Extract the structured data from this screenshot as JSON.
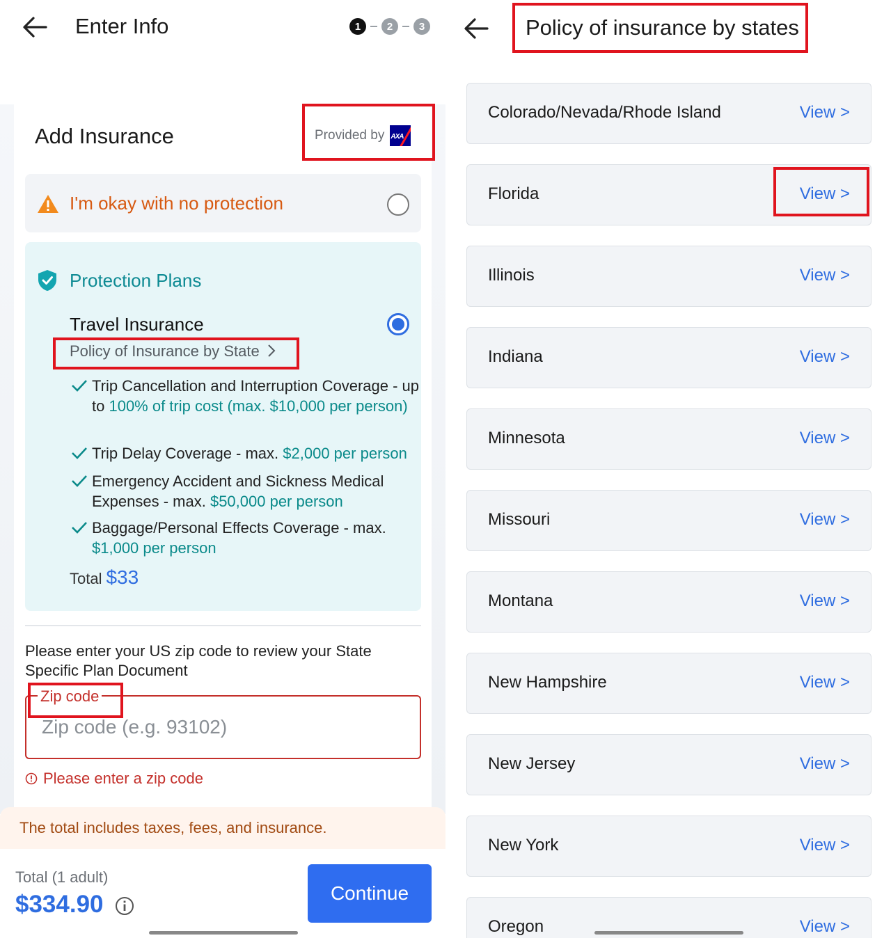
{
  "left": {
    "topbar": {
      "title": "Enter Info",
      "steps": [
        "1",
        "2",
        "3"
      ],
      "active_step": 1
    },
    "section_title": "Add Insurance",
    "provider": {
      "label": "Provided by",
      "logo_text": "AXA",
      "logo_color": "#00008f"
    },
    "no_protection": {
      "label": "I'm okay with no protection",
      "selected": false
    },
    "protection": {
      "heading": "Protection Plans",
      "plan_title": "Travel Insurance",
      "policy_link": "Policy of Insurance by State",
      "selected": true,
      "benefits": [
        {
          "text": "Trip Cancellation and Interruption Coverage - up to ",
          "highlight": "100% of trip cost (max. $10,000 per person)"
        },
        {
          "text": "Trip Delay Coverage - max. ",
          "highlight": "$2,000 per person"
        },
        {
          "text": "Emergency Accident and Sickness Medical Expenses - max. ",
          "highlight": "$50,000 per person"
        },
        {
          "text": "Baggage/Personal Effects Coverage - max. ",
          "highlight": "$1,000 per person"
        }
      ],
      "total_label": "Total",
      "total_amount": "$33"
    },
    "zip": {
      "message": "Please enter your US zip code to review your State Specific Plan Document",
      "legend": "Zip code",
      "placeholder": "Zip code (e.g. 93102)",
      "value": "",
      "error": "Please enter a zip code"
    },
    "notice": "The total includes taxes, fees, and insurance.",
    "footer": {
      "total_label": "Total (1 adult)",
      "total_amount": "$334.90",
      "continue_label": "Continue"
    }
  },
  "right": {
    "title": "Policy of insurance by states",
    "view_label": "View >",
    "states": [
      "Colorado/Nevada/Rhode Island",
      "Florida",
      "Illinois",
      "Indiana",
      "Minnesota",
      "Missouri",
      "Montana",
      "New Hampshire",
      "New Jersey",
      "New York",
      "Oregon"
    ]
  },
  "colors": {
    "accent": "#2f6de0",
    "teal": "#0d8a93",
    "warning": "#d75a12",
    "error": "#c4302b",
    "highlight_box": "#e0141e"
  }
}
